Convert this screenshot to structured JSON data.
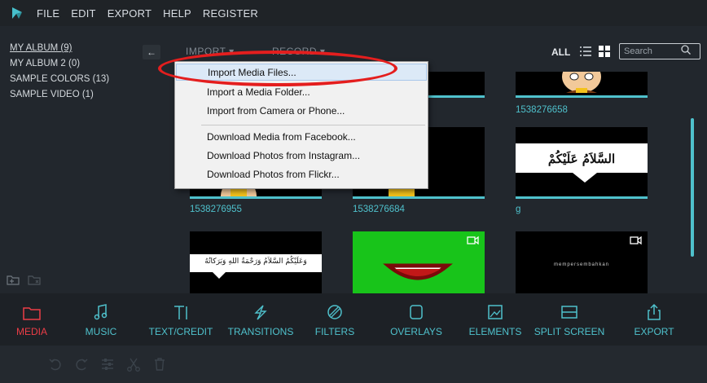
{
  "menu": {
    "items": [
      "FILE",
      "EDIT",
      "EXPORT",
      "HELP",
      "REGISTER"
    ]
  },
  "library": {
    "items": [
      "MY ALBUM (9)",
      "MY ALBUM 2 (0)",
      "SAMPLE COLORS (13)",
      "SAMPLE VIDEO (1)"
    ],
    "collapse_glyph": "←"
  },
  "toolbar": {
    "import_label": "IMPORT ▾",
    "record_label": "RECORD ▾",
    "all_label": "ALL",
    "search_placeholder": "Search"
  },
  "dropdown": {
    "items": [
      "Import Media Files...",
      "Import a Media Folder...",
      "Import from Camera or Phone...",
      "Download Media from Facebook...",
      "Download Photos from Instagram...",
      "Download Photos from Flickr..."
    ]
  },
  "media": {
    "labels": [
      "1538276658",
      "1538276955",
      "1538276684",
      "g"
    ],
    "arabic_title": "السَّلاَمُ عَلَيْكُمْ",
    "arabic_caption": "وَعَلَيْكُمُ السَّلاَمُ وَرَحْمَةُ اللهِ وَبَرَكاتُهُ",
    "intro_text": "mempersembahkan"
  },
  "tabs": [
    "MEDIA",
    "MUSIC",
    "TEXT/CREDIT",
    "TRANSITIONS",
    "FILTERS",
    "OVERLAYS",
    "ELEMENTS",
    "SPLIT SCREEN",
    "EXPORT"
  ],
  "icons": [
    "logo-icon",
    "list-view-icon",
    "grid-view-icon",
    "search-icon",
    "add-folder-icon",
    "remove-folder-icon",
    "video-icon",
    "undo-icon",
    "redo-icon",
    "adjust-icon",
    "cut-icon",
    "delete-icon"
  ],
  "colors": {
    "accent": "#4fc1cc",
    "active_tab": "#ec3d47",
    "highlight_oval": "#e41e1e",
    "green_screen": "#18c41a"
  }
}
